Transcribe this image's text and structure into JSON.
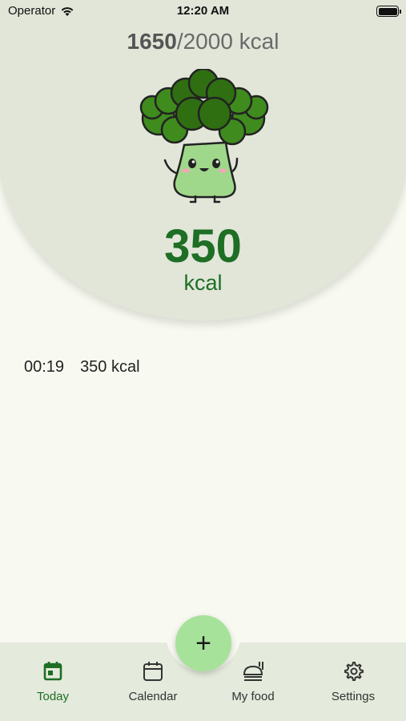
{
  "status_bar": {
    "carrier": "Operator",
    "time": "12:20 AM",
    "battery_level": 1.0
  },
  "summary": {
    "consumed": "1650",
    "separator_goal": "/2000 kcal",
    "remaining_value": "350",
    "remaining_unit": "kcal",
    "accent_color": "#1e6e25"
  },
  "entries": [
    {
      "time": "00:19",
      "amount": "350 kcal"
    }
  ],
  "fab": {
    "label": "+",
    "icon": "plus-icon",
    "color": "#a7e29a"
  },
  "tabs": [
    {
      "label": "Today",
      "icon": "calendar-today-icon",
      "active": true
    },
    {
      "label": "Calendar",
      "icon": "calendar-icon",
      "active": false
    },
    {
      "label": "My food",
      "icon": "food-icon",
      "active": false
    },
    {
      "label": "Settings",
      "icon": "gear-icon",
      "active": false
    }
  ]
}
